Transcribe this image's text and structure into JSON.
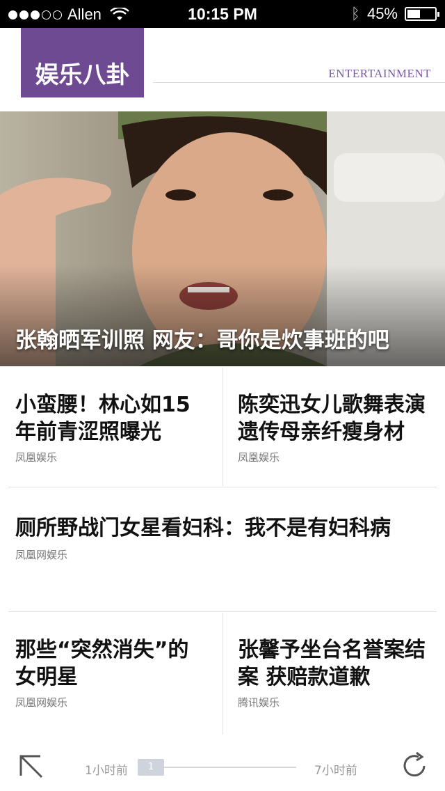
{
  "status_bar": {
    "carrier": "Allen",
    "time": "10:15 PM",
    "battery": "45%",
    "signal_bars": 3
  },
  "header": {
    "logo_text": "娱乐八卦",
    "section_tag": "ENTERTAINMENT",
    "accent_color": "#6e4a93"
  },
  "hero": {
    "caption": "张翰晒军训照 网友：哥你是炊事班的吧"
  },
  "articles": [
    {
      "title": "小蛮腰！林心如15年前青涩照曝光",
      "source": "凤凰娱乐"
    },
    {
      "title": "陈奕迅女儿歌舞表演遗传母亲纤瘦身材",
      "source": "凤凰娱乐"
    },
    {
      "title": "厕所野战门女星看妇科：我不是有妇科病",
      "source": "凤凰网娱乐"
    },
    {
      "title": "那些“突然消失”的女明星",
      "source": "凤凰网娱乐"
    },
    {
      "title": "张馨予坐台名誉案结案 获赔款道歉",
      "source": "腾讯娱乐"
    }
  ],
  "timeline": {
    "start_label": "1小时前",
    "end_label": "7小时前",
    "current_page": "1"
  },
  "icons": {
    "back": "arrow-up-left-icon",
    "refresh": "refresh-icon",
    "wifi": "wifi-icon",
    "bluetooth": "bluetooth-icon",
    "battery": "battery-icon"
  }
}
